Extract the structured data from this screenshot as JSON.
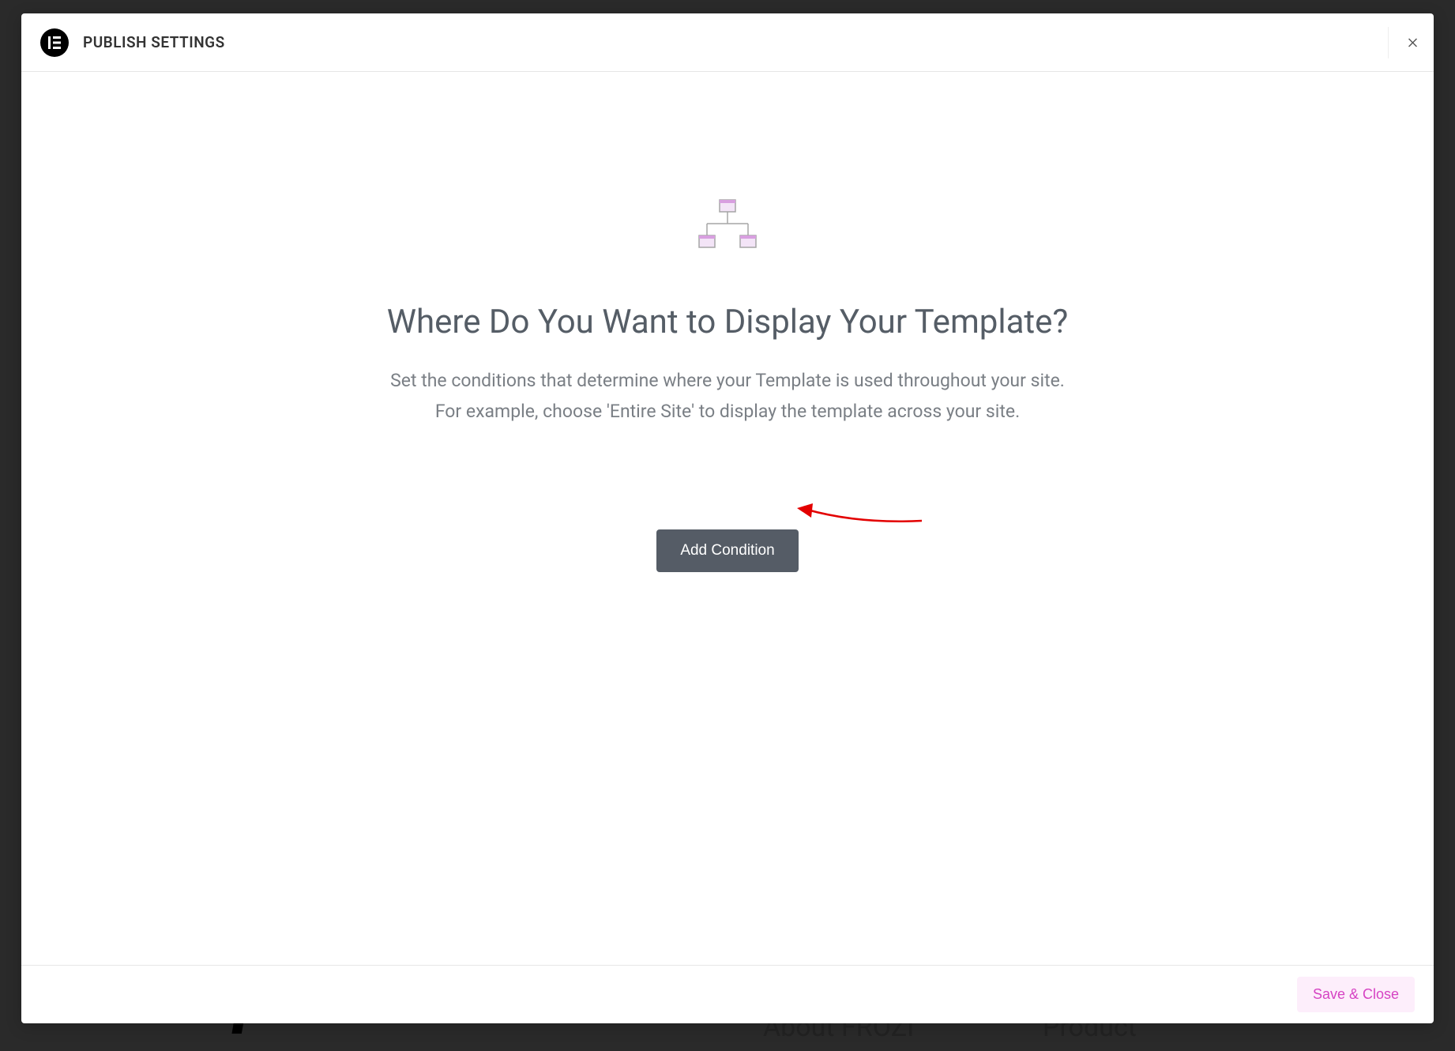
{
  "header": {
    "logo_text": "E",
    "title": "PUBLISH SETTINGS"
  },
  "body": {
    "heading": "Where Do You Want to Display Your Template?",
    "description_line1": "Set the conditions that determine where your Template is used throughout your site.",
    "description_line2": "For example, choose 'Entire Site' to display the template across your site.",
    "add_condition_label": "Add Condition"
  },
  "footer": {
    "save_close_label": "Save & Close"
  },
  "background": {
    "about_text": "About FROZI",
    "product_text": "Product",
    "logo_fragment": "f"
  }
}
